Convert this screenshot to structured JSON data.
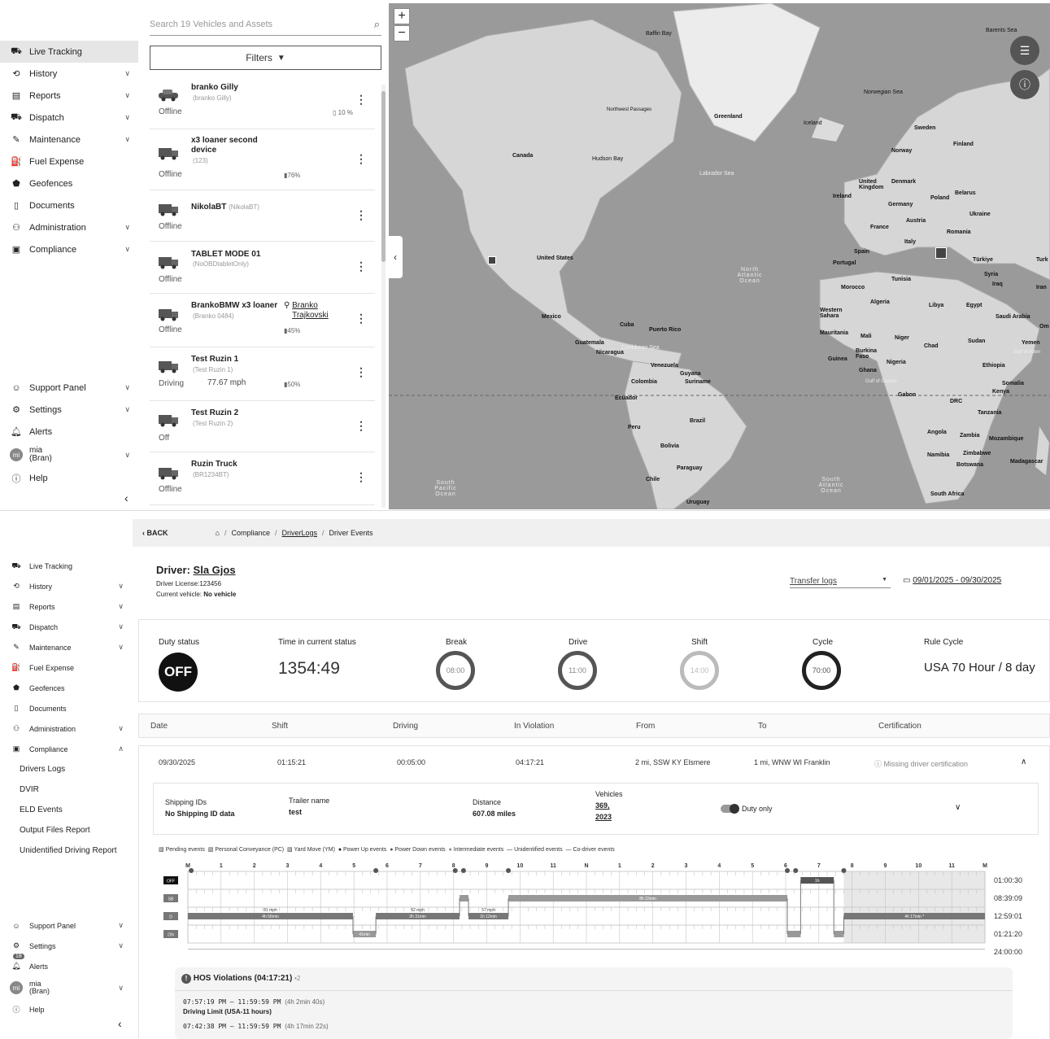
{
  "nav": {
    "live_tracking": "Live Tracking",
    "history": "History",
    "reports": "Reports",
    "dispatch": "Dispatch",
    "maintenance": "Maintenance",
    "fuel_expense": "Fuel Expense",
    "geofences": "Geofences",
    "documents": "Documents",
    "administration": "Administration",
    "compliance": "Compliance",
    "support_panel": "Support Panel",
    "settings": "Settings",
    "alerts": "Alerts",
    "user_initials": "mi",
    "user_name": "mia",
    "user_org": "(Bran)",
    "help": "Help",
    "alerts_badge": "18"
  },
  "compliance_sub": {
    "drivers_logs": "Drivers Logs",
    "dvir": "DVIR",
    "eld_events": "ELD Events",
    "output_files": "Output Files Report",
    "unidentified": "Unidentified Driving Report"
  },
  "vehicles": {
    "search_placeholder": "Search 19 Vehicles and Assets",
    "filters_label": "Filters",
    "list": [
      {
        "name": "branko Gilly",
        "code": "(branko Gilly)",
        "status": "Offline",
        "battery": "10 %"
      },
      {
        "name": "x3 loaner second device",
        "code": "(123)",
        "status": "Offline",
        "battery": "76%"
      },
      {
        "name": "NikolaBT",
        "code": "(NikolaBT)",
        "status": "Offline",
        "battery": ""
      },
      {
        "name": "TABLET MODE 01",
        "code": "(NoOBDtabletOnly)",
        "status": "Offline",
        "battery": ""
      },
      {
        "name": "BrankoBMW x3 loaner",
        "code": "(Branko 0484)",
        "status": "Offline",
        "battery": "45%",
        "driver": "Branko Trajkovski"
      },
      {
        "name": "Test Ruzin 1",
        "code": "(Test Ruzin 1)",
        "status": "Driving",
        "speed": "77.67 mph",
        "battery": "50%"
      },
      {
        "name": "Test Ruzin 2",
        "code": "(Test Ruzin 2)",
        "status": "Off",
        "battery": ""
      },
      {
        "name": "Ruzin Truck",
        "code": "(BR1234BT)",
        "status": "Offline",
        "battery": ""
      }
    ]
  },
  "map": {
    "labels": [
      "Baffin Bay",
      "Greenland",
      "Iceland",
      "Norwegian Sea",
      "Barents Sea",
      "Canada",
      "Hudson Bay",
      "Labrador Sea",
      "Northwest Passages",
      "United States",
      "Mexico",
      "Cuba",
      "Puerto Rico",
      "Guatemala",
      "Nicaragua",
      "Caribbean Sea",
      "Venezuela",
      "Colombia",
      "Guyana",
      "Suriname",
      "Ecuador",
      "Peru",
      "Brazil",
      "Bolivia",
      "Paraguay",
      "Chile",
      "Uruguay",
      "North Atlantic Ocean",
      "South Atlantic Ocean",
      "South Pacific Ocean",
      "Sweden",
      "Finland",
      "Norway",
      "United Kingdom",
      "Ireland",
      "Denmark",
      "Poland",
      "Belarus",
      "Germany",
      "Ukraine",
      "Austria",
      "France",
      "Romania",
      "Italy",
      "Spain",
      "Portugal",
      "Türkiye",
      "Turk",
      "Syria",
      "Iraq",
      "Iran",
      "Tunisia",
      "Morocco",
      "Algeria",
      "Libya",
      "Egypt",
      "Saudi Arabia",
      "Om",
      "Western Sahara",
      "Mauritania",
      "Mali",
      "Niger",
      "Chad",
      "Sudan",
      "Yemen",
      "Gulf of Aden",
      "Guinea",
      "Burkina Faso",
      "Nigeria",
      "Ghana",
      "Gulf of Guinea",
      "Ethiopia",
      "Somalia",
      "Gabon",
      "Kenya",
      "DRC",
      "Tanzania",
      "Angola",
      "Zambia",
      "Mozambique",
      "Namibia",
      "Zimbabwe",
      "Botswana",
      "Madagascar",
      "South Africa"
    ],
    "zoom_in": "+",
    "zoom_out": "−"
  },
  "breadcrumb": {
    "back": "BACK",
    "compliance": "Compliance",
    "driver_logs": "DriverLogs",
    "driver_events": "Driver Events"
  },
  "driver": {
    "label": "Driver:",
    "name": "Sla Gjos",
    "license": "Driver License:123456",
    "vehicle_label": "Current vehicle:",
    "vehicle": "No vehicle",
    "transfer_logs": "Transfer logs",
    "date_range": "09/01/2025 - 09/30/2025"
  },
  "status": {
    "duty_status_label": "Duty status",
    "duty_status": "OFF",
    "time_label": "Time in current status",
    "time": "1354:49",
    "break_label": "Break",
    "break": "08:00",
    "drive_label": "Drive",
    "drive": "11:00",
    "shift_label": "Shift",
    "shift": "14:00",
    "cycle_label": "Cycle",
    "cycle": "70:00",
    "rule_label": "Rule Cycle",
    "rule": "USA 70 Hour / 8 day"
  },
  "table": {
    "headers": [
      "Date",
      "Shift",
      "Driving",
      "In Violation",
      "From",
      "To",
      "Certification"
    ],
    "row": [
      "09/30/2025",
      "01:15:21",
      "00:05:00",
      "04:17:21",
      "2 mi, SSW KY Elsmere",
      "1 mi, WNW WI Franklin",
      "Missing driver certification"
    ]
  },
  "details": {
    "shipping_label": "Shipping IDs",
    "shipping": "No Shipping ID data",
    "trailer_label": "Trailer name",
    "trailer": "test",
    "distance_label": "Distance",
    "distance": "607.08 miles",
    "vehicles_label": "Vehicles",
    "vehicles_1": "369,",
    "vehicles_2": "2023",
    "duty_only": "Duty only"
  },
  "legend": [
    "Pending events",
    "Personal Conveyance (PC)",
    "Yard Move (YM)",
    "Power Up events",
    "Power Down events",
    "Intermediate events",
    "Unidentified events",
    "Co-driver events"
  ],
  "chart": {
    "hours": [
      "M",
      "1",
      "2",
      "3",
      "4",
      "5",
      "6",
      "7",
      "8",
      "9",
      "10",
      "11",
      "N",
      "1",
      "2",
      "3",
      "4",
      "5",
      "6",
      "7",
      "8",
      "9",
      "10",
      "11",
      "M"
    ],
    "rows": [
      "OFF",
      "SB",
      "D",
      "ON"
    ],
    "totals": [
      "01:00:30",
      "08:39:09",
      "12:59:01",
      "01:21:20",
      "24:00:00"
    ],
    "segments": [
      {
        "row": "D",
        "start": 0,
        "end": 4.97,
        "label": "4h 56min",
        "speed": "81 mph"
      },
      {
        "row": "ON",
        "start": 4.97,
        "end": 5.66,
        "label": "41min",
        "speed": ""
      },
      {
        "row": "D",
        "start": 5.66,
        "end": 8.18,
        "label": "2h 31min",
        "speed": "52 mph"
      },
      {
        "row": "SB",
        "start": 8.18,
        "end": 8.45,
        "label": "",
        "speed": ""
      },
      {
        "row": "D",
        "start": 8.45,
        "end": 9.65,
        "label": "1h 12min",
        "speed": "57 mph"
      },
      {
        "row": "SB",
        "start": 9.65,
        "end": 18.05,
        "label": "8h 23min",
        "speed": ""
      },
      {
        "row": "ON",
        "start": 18.05,
        "end": 18.45,
        "label": "",
        "speed": ""
      },
      {
        "row": "OFF",
        "start": 18.45,
        "end": 19.45,
        "label": "1h",
        "speed": ""
      },
      {
        "row": "ON",
        "start": 19.45,
        "end": 19.75,
        "label": "",
        "speed": ""
      },
      {
        "row": "D",
        "start": 19.75,
        "end": 24,
        "label": "4h 17min *",
        "speed": ""
      }
    ],
    "vehicle_label": "369"
  },
  "violations": {
    "title": "HOS Violations (04:17:21)",
    "count": "•2",
    "items": [
      {
        "time": "07:57:19 PM – 11:59:59 PM",
        "dur": "(4h 2min 40s)",
        "rule": "Driving Limit (USA-11 hours)"
      },
      {
        "time": "07:42:38 PM – 11:59:59 PM",
        "dur": "(4h 17min 22s)",
        "rule": ""
      }
    ]
  }
}
